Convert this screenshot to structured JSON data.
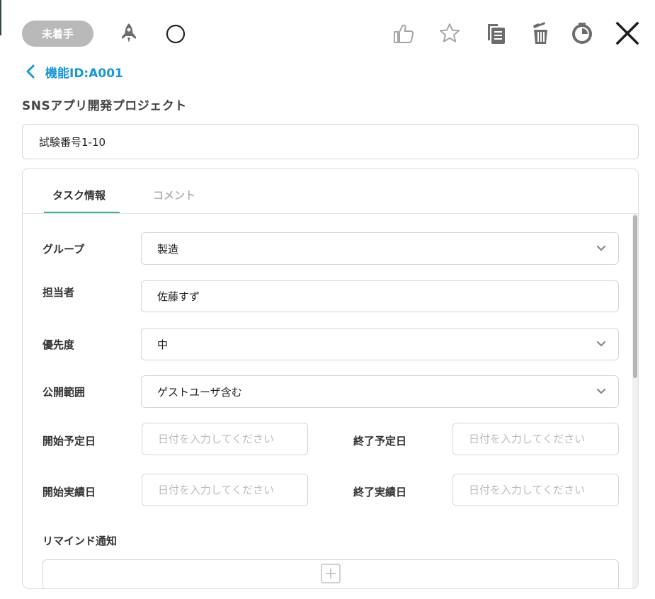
{
  "header": {
    "status_badge": "未着手",
    "icons": [
      "rocket-icon",
      "circle-icon",
      "thumbs-up-icon",
      "star-icon",
      "copy-icon",
      "trash-icon",
      "timer-icon",
      "close-icon"
    ]
  },
  "breadcrumb": {
    "back_label": "機能ID:A001"
  },
  "project": {
    "name": "SNSアプリ開発プロジェクト"
  },
  "task": {
    "title": "試験番号1-10"
  },
  "tabs": [
    {
      "label": "タスク情報",
      "active": true
    },
    {
      "label": "コメント",
      "active": false
    }
  ],
  "form": {
    "group": {
      "label": "グループ",
      "value": "製造"
    },
    "assignee": {
      "label": "担当者",
      "value": "佐藤すず"
    },
    "priority": {
      "label": "優先度",
      "value": "中"
    },
    "visibility": {
      "label": "公開範囲",
      "value": "ゲストユーザ含む"
    },
    "planned_start": {
      "label": "開始予定日",
      "placeholder": "日付を入力してください"
    },
    "planned_end": {
      "label": "終了予定日",
      "placeholder": "日付を入力してください"
    },
    "actual_start": {
      "label": "開始実績日",
      "placeholder": "日付を入力してください"
    },
    "actual_end": {
      "label": "終了実績日",
      "placeholder": "日付を入力してください"
    },
    "reminder": {
      "label": "リマインド通知"
    }
  },
  "colors": {
    "accent_blue": "#1a97d4",
    "tab_underline": "#3db08a",
    "badge_bg": "#b9b9b9",
    "icon_gray": "#6d6d6d"
  }
}
